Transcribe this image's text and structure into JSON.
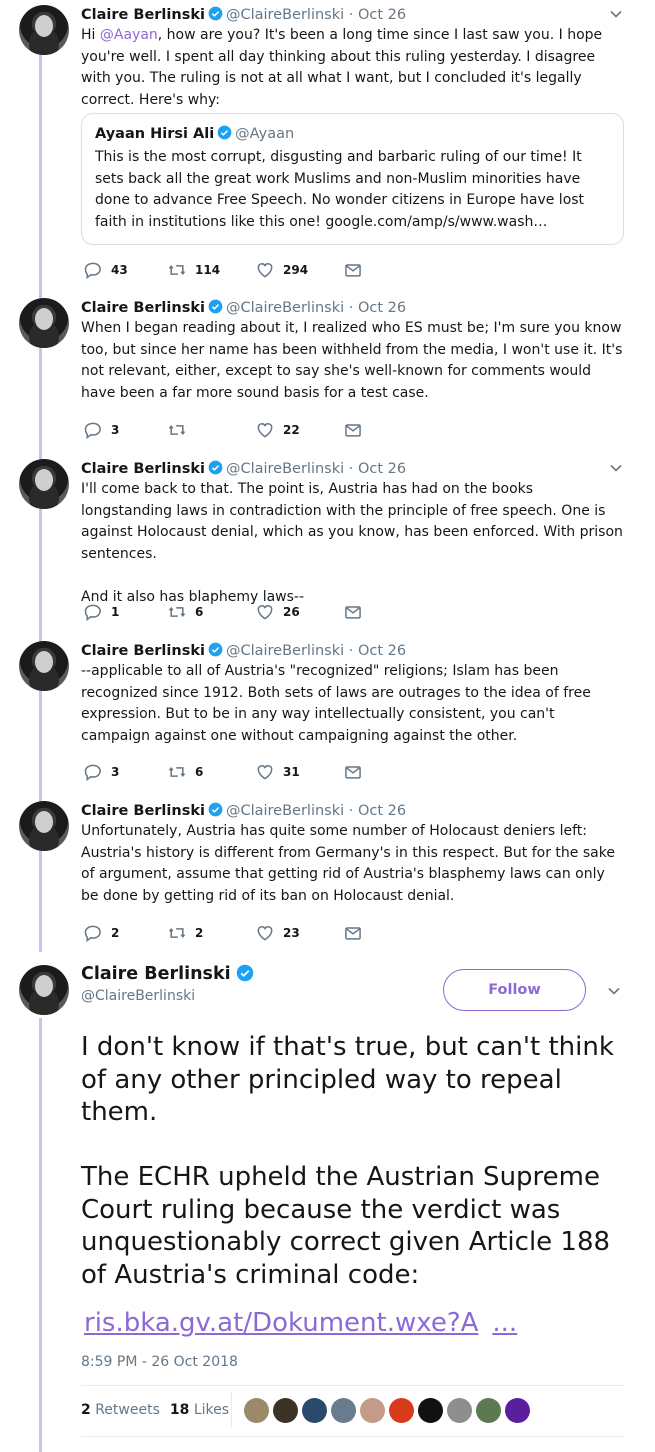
{
  "thread": [
    {
      "name": "Claire Berlinski",
      "handle": "@ClaireBerlinski",
      "dot": "·",
      "date": "Oct 26",
      "text_pre": "Hi ",
      "mention": "@Aayan",
      "text_post": ", how are you? It's been a long time since I last saw you. I hope you're well. I spent all day thinking about this ruling yesterday. I disagree with you. The ruling is not at all what I want, but I concluded it's legally correct. Here's why:",
      "quote": {
        "name": "Ayaan Hirsi Ali",
        "handle": "@Ayaan",
        "text": "This is the most corrupt, disgusting and barbaric ruling of our time! It sets back all the great work Muslims and non-Muslim minorities have done to advance Free Speech. No wonder citizens in Europe have lost faith in institutions like this one!   google.com/amp/s/www.wash…"
      },
      "replies": "43",
      "retweets": "114",
      "likes": "294"
    },
    {
      "name": "Claire Berlinski",
      "handle": "@ClaireBerlinski",
      "dot": "·",
      "date": "Oct 26",
      "text": "When I began reading about it, I realized who ES must be; I'm sure you know too, but since her name has been withheld from the media, I won't use it. It's not relevant, either, except to say she's well-known for comments would have been a far more sound basis for a test case.",
      "replies": "3",
      "retweets": "",
      "likes": "22"
    },
    {
      "name": "Claire Berlinski",
      "handle": "@ClaireBerlinski",
      "dot": "·",
      "date": "Oct 26",
      "text": "I'll come back to that. The point is, Austria has had on the books longstanding laws in contradiction with the principle of free speech. One is against Holocaust denial, which as you know, has been enforced. With prison sentences.\n\nAnd it also has blaphemy laws--",
      "replies": "1",
      "retweets": "6",
      "likes": "26"
    },
    {
      "name": "Claire Berlinski",
      "handle": "@ClaireBerlinski",
      "dot": "·",
      "date": "Oct 26",
      "text": "--applicable to all of Austria's \"recognized\" religions; Islam has been recognized since 1912. Both sets of laws are outrages to the idea of free expression. But to be in any way intellectually consistent, you can't campaign against one without campaigning against the other.",
      "replies": "3",
      "retweets": "6",
      "likes": "31"
    },
    {
      "name": "Claire Berlinski",
      "handle": "@ClaireBerlinski",
      "dot": "·",
      "date": "Oct 26",
      "text": "Unfortunately, Austria has quite some number of Holocaust deniers left: Austria's history is different from Germany's in this respect. But for the sake of argument, assume that getting rid of Austria's blasphemy laws can only be done by getting rid of its ban on Holocaust denial.",
      "replies": "2",
      "retweets": "2",
      "likes": "23"
    }
  ],
  "main_tweet": {
    "name": "Claire Berlinski",
    "handle": "@ClaireBerlinski",
    "follow_label": "Follow",
    "text": "I don't know if that's true, but can't think of any other principled way to repeal them.\n\nThe ECHR upheld the Austrian Supreme Court ruling because the verdict was unquestionably correct given Article 188 of Austria's criminal code:",
    "link": "ris.bka.gv.at/Dokument.wxe?A",
    "link_ellipsis": "...",
    "timestamp": "8:59 PM - 26 Oct 2018",
    "retweets_count": "2",
    "retweets_label": "Retweets",
    "likes_count": "18",
    "likes_label": "Likes"
  },
  "icons": {
    "verified": "verified-badge-icon",
    "caret": "chevron-down-icon",
    "reply": "reply-icon",
    "retweet": "retweet-icon",
    "like": "heart-icon",
    "dm": "envelope-icon"
  },
  "colors": {
    "accent": "#8b6ad6",
    "thread_line": "#c9c2ef",
    "verified": "#1da1f2",
    "muted": "#657786"
  }
}
